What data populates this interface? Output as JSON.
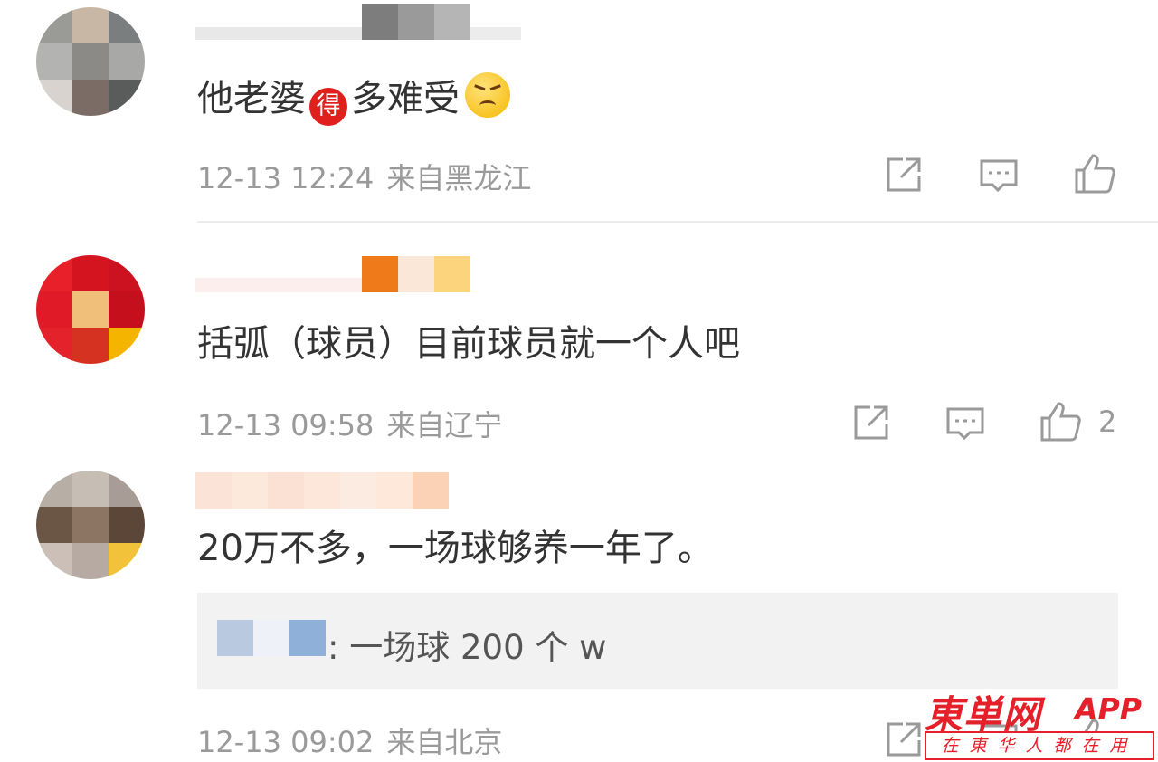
{
  "comments": [
    {
      "text_parts": [
        "他老婆",
        "得",
        "多难受"
      ],
      "emoji_face": "persevering-face",
      "date": "12-13 12:24",
      "location": "来自黑龙江",
      "like_count": ""
    },
    {
      "text": "括弧（球员）目前球员就一个人吧",
      "date": "12-13 09:58",
      "location": "来自辽宁",
      "like_count": "2"
    },
    {
      "text": "20万不多，一场球够养一年了。",
      "reply_text": ": 一场球 200 个 w",
      "date": "12-13 09:02",
      "location": "来自北京"
    }
  ],
  "icons": {
    "share": "share-icon",
    "comment": "comment-icon",
    "like": "like-icon"
  },
  "colors": {
    "meta_gray": "#9a9a9a",
    "divider": "#ececec",
    "reply_bg": "#f2f2f2",
    "watermark_red": "#e4202a"
  },
  "watermark": {
    "title": "東単网",
    "app": "APP",
    "slogan": "在東华人都在用"
  }
}
